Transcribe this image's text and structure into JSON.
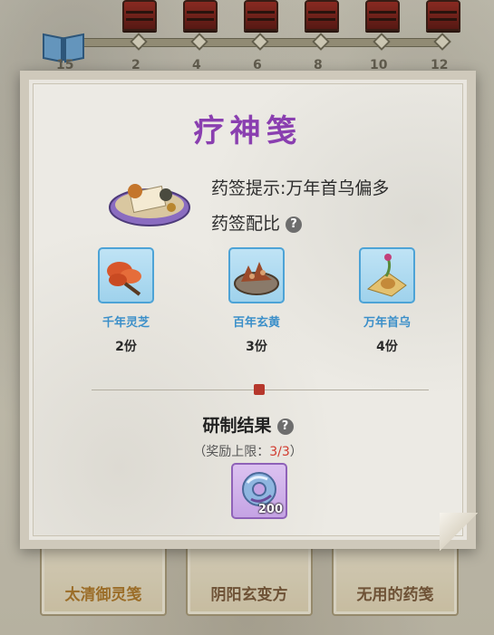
{
  "progress": {
    "milestones": [
      "15",
      "2",
      "4",
      "6",
      "8",
      "10",
      "12"
    ]
  },
  "bottom_tabs": [
    {
      "label": "太清御灵笺"
    },
    {
      "label": "阴阳玄变方"
    },
    {
      "label": "无用的药笺"
    }
  ],
  "dialog": {
    "title": "疗神笺",
    "hint": "药签提示:万年首乌偏多",
    "ratio_label": "药签配比",
    "help_glyph": "?",
    "ingredients": [
      {
        "name": "千年灵芝",
        "qty": "2份",
        "icon": "lingzhi-icon"
      },
      {
        "name": "百年玄黄",
        "qty": "3份",
        "icon": "xuanhuang-icon"
      },
      {
        "name": "万年首乌",
        "qty": "4份",
        "icon": "shouwu-icon"
      }
    ],
    "result_title": "研制结果",
    "reward_limit_prefix": "（奖励上限：",
    "reward_limit_value": "3/3",
    "reward_limit_suffix": "）",
    "reward": {
      "icon": "jade-disc-icon",
      "count": "200"
    }
  },
  "colors": {
    "title_purple": "#8a3fb0",
    "ingredient_blue": "#3b8fc9",
    "limit_red": "#d13b2f"
  }
}
